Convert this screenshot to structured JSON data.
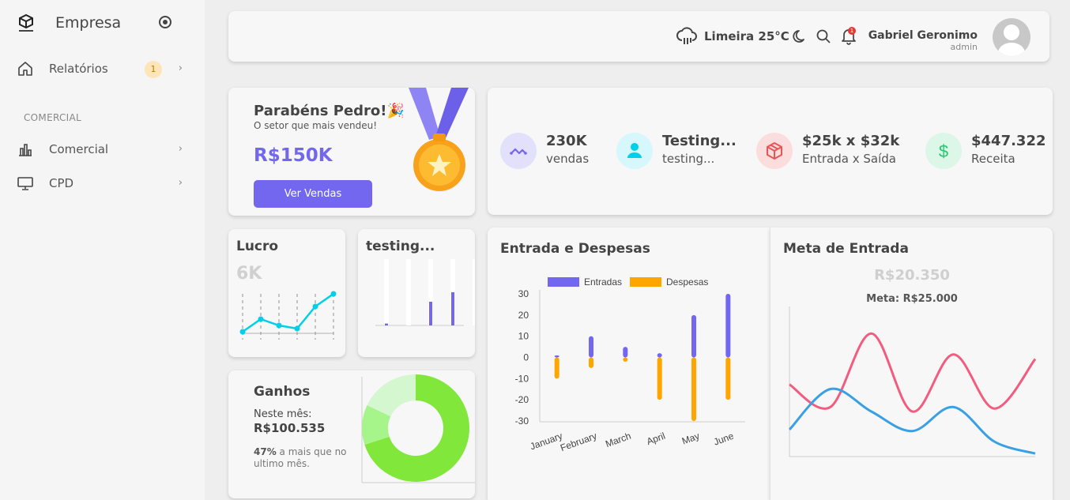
{
  "sidebar": {
    "brand": "Empresa",
    "items": [
      {
        "label": "Relatórios",
        "badge": "1",
        "icon": "home-icon"
      },
      {
        "label": "Comercial",
        "icon": "bar-chart-icon"
      },
      {
        "label": "CPD",
        "icon": "monitor-icon"
      }
    ],
    "section": "COMERCIAL"
  },
  "header": {
    "weather": "Limeira 25°C",
    "notification_count": "1",
    "user_name": "Gabriel Geronimo",
    "user_role": "admin"
  },
  "congrats": {
    "title": "Parabéns Pedro!🎉",
    "subtitle": "O setor que mais vendeu!",
    "amount": "R$150K",
    "button": "Ver Vendas"
  },
  "stats": [
    {
      "value": "230K",
      "caption": "vendas",
      "icon": "trending-icon",
      "color": "#7367f0",
      "bg": "#e3e0fb"
    },
    {
      "value": "Testing...",
      "caption": "testing...",
      "icon": "user-icon",
      "color": "#00cfe8",
      "bg": "#d6f7fb"
    },
    {
      "value": "$25k x $32k",
      "caption": "Entrada x Saída",
      "icon": "box-icon",
      "color": "#ea5455",
      "bg": "#fbdddd"
    },
    {
      "value": "$447.322",
      "caption": "Receita",
      "icon": "dollar-icon",
      "color": "#28c76f",
      "bg": "#dcf6e8"
    }
  ],
  "lucro": {
    "title": "Lucro",
    "value": "6K"
  },
  "testing_card": {
    "title": "testing..."
  },
  "ganhos": {
    "title": "Ganhos",
    "label": "Neste mês:",
    "amount": "R$100.535",
    "note_pct": "47%",
    "note_rest": " a mais que no ultimo mês."
  },
  "entrada_panel": {
    "title": "Entrada e Despesas"
  },
  "meta_panel": {
    "title": "Meta de Entrada",
    "value": "R$20.350",
    "goal": "Meta: R$25.000"
  },
  "chart_data": [
    {
      "type": "line",
      "title": "Lucro",
      "values": [
        0,
        20,
        10,
        5,
        40,
        60
      ],
      "color": "#00cfe8"
    },
    {
      "type": "bar",
      "title": "testing...",
      "values": [
        2,
        0,
        25,
        35,
        0
      ],
      "color": "#7367f0"
    },
    {
      "type": "pie",
      "title": "Ganhos",
      "values": [
        70,
        12,
        18
      ],
      "colors": [
        "#82e73b",
        "#a5f58b",
        "#d4f7d0"
      ]
    },
    {
      "type": "bar",
      "title": "Entrada e Despesas",
      "categories": [
        "January",
        "February",
        "March",
        "April",
        "May",
        "June"
      ],
      "series": [
        {
          "name": "Entradas",
          "values": [
            1,
            10,
            5,
            2,
            20,
            30
          ],
          "color": "#7367f0"
        },
        {
          "name": "Despesas",
          "values": [
            -10,
            -5,
            -2,
            -20,
            -30,
            -20
          ],
          "color": "#ffa500"
        }
      ],
      "yticks": [
        30,
        20,
        10,
        0,
        -10,
        -20,
        -30
      ],
      "ylim": [
        -30,
        30
      ],
      "legend": "top"
    },
    {
      "type": "line",
      "title": "Meta de Entrada",
      "series": [
        {
          "values": [
            48,
            33,
            82,
            30,
            68,
            32,
            65
          ],
          "color": "#f25c7f"
        },
        {
          "values": [
            18,
            45,
            30,
            17,
            33,
            10,
            2
          ],
          "color": "#3aa0e4"
        }
      ],
      "ylim": [
        0,
        100
      ]
    }
  ]
}
